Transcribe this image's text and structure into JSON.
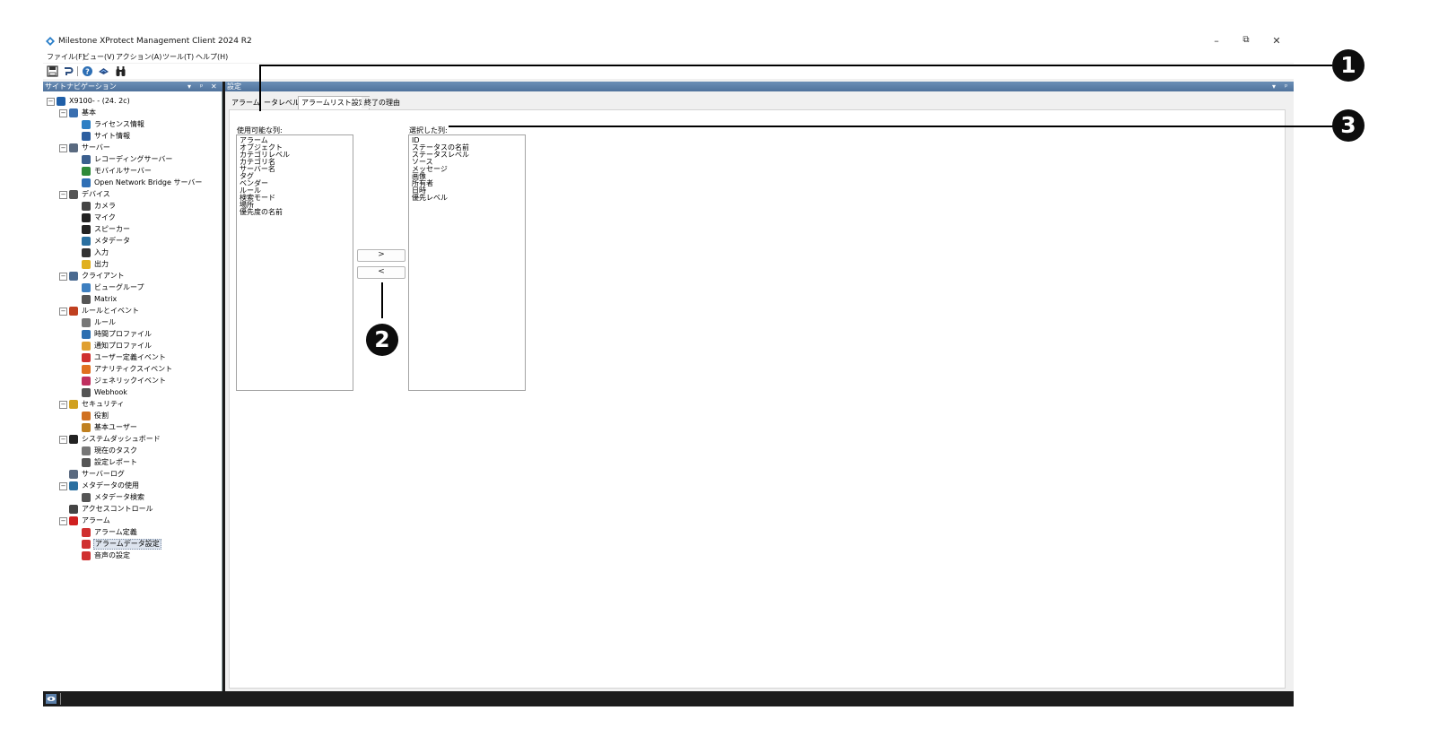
{
  "window": {
    "title": "Milestone XProtect Management Client 2024 R2",
    "minimize_glyph": "–",
    "restore_glyph": "⧉",
    "close_glyph": "✕"
  },
  "menu": [
    "ファイル(F)",
    "ビュー(V)",
    "アクション(A)",
    "ツール(T)",
    "ヘルプ(H)"
  ],
  "toolbar": {
    "icons": [
      "save-icon",
      "undo-icon",
      "help-icon",
      "connect-icon",
      "find-icon"
    ]
  },
  "nav_pane": {
    "title": "サイトナビゲーション",
    "controls": [
      "▾",
      "ᵖ",
      "✕"
    ]
  },
  "tree": [
    {
      "label": "X9100-          - (24. 2c)",
      "level": 0,
      "expander": "⊟",
      "icon": "server-site-icon",
      "color": "#1f5fa8"
    },
    {
      "label": "基本",
      "level": 1,
      "expander": "⊟",
      "icon": "book-icon",
      "color": "#3a6fb0"
    },
    {
      "label": "ライセンス情報",
      "level": 2,
      "icon": "license-icon",
      "color": "#2d7fc4"
    },
    {
      "label": "サイト情報",
      "level": 2,
      "icon": "site-info-icon",
      "color": "#2d5fa0"
    },
    {
      "label": "サーバー",
      "level": 1,
      "expander": "⊟",
      "icon": "server-icon",
      "color": "#5a6a80"
    },
    {
      "label": "レコーディングサーバー",
      "level": 2,
      "icon": "recording-server-icon",
      "color": "#3b5f8e"
    },
    {
      "label": "モバイルサーバー",
      "level": 2,
      "icon": "mobile-server-icon",
      "color": "#2f8a3a"
    },
    {
      "label": "Open Network Bridge サーバー",
      "level": 2,
      "icon": "bridge-icon",
      "color": "#2f6fb5"
    },
    {
      "label": "デバイス",
      "level": 1,
      "expander": "⊟",
      "icon": "devices-icon",
      "color": "#555"
    },
    {
      "label": "カメラ",
      "level": 2,
      "icon": "camera-icon",
      "color": "#444"
    },
    {
      "label": "マイク",
      "level": 2,
      "icon": "microphone-icon",
      "color": "#222"
    },
    {
      "label": "スピーカー",
      "level": 2,
      "icon": "speaker-icon",
      "color": "#222"
    },
    {
      "label": "メタデータ",
      "level": 2,
      "icon": "metadata-icon",
      "color": "#2a6fa0"
    },
    {
      "label": "入力",
      "level": 2,
      "icon": "input-icon",
      "color": "#333"
    },
    {
      "label": "出力",
      "level": 2,
      "icon": "output-icon",
      "color": "#e0b020"
    },
    {
      "label": "クライアント",
      "level": 1,
      "expander": "⊟",
      "icon": "client-icon",
      "color": "#4a6a90"
    },
    {
      "label": "ビューグループ",
      "level": 2,
      "icon": "view-group-icon",
      "color": "#3d7fc0"
    },
    {
      "label": "Matrix",
      "level": 2,
      "icon": "matrix-icon",
      "color": "#555"
    },
    {
      "label": "ルールとイベント",
      "level": 1,
      "expander": "⊟",
      "icon": "rules-events-icon",
      "color": "#c04020"
    },
    {
      "label": "ルール",
      "level": 2,
      "icon": "rule-icon",
      "color": "#777"
    },
    {
      "label": "時間プロファイル",
      "level": 2,
      "icon": "clock-icon",
      "color": "#2d6fb0"
    },
    {
      "label": "通知プロファイル",
      "level": 2,
      "icon": "envelope-icon",
      "color": "#e0a030"
    },
    {
      "label": "ユーザー定義イベント",
      "level": 2,
      "icon": "user-event-icon",
      "color": "#d03030"
    },
    {
      "label": "アナリティクスイベント",
      "level": 2,
      "icon": "analytics-event-icon",
      "color": "#e07020"
    },
    {
      "label": "ジェネリックイベント",
      "level": 2,
      "icon": "generic-event-icon",
      "color": "#c03060"
    },
    {
      "label": "Webhook",
      "level": 2,
      "icon": "webhook-icon",
      "color": "#555"
    },
    {
      "label": "セキュリティ",
      "level": 1,
      "expander": "⊟",
      "icon": "security-icon",
      "color": "#d0a020"
    },
    {
      "label": "役割",
      "level": 2,
      "icon": "role-icon",
      "color": "#d07020"
    },
    {
      "label": "基本ユーザー",
      "level": 2,
      "icon": "basic-user-icon",
      "color": "#c08020"
    },
    {
      "label": "システムダッシュボード",
      "level": 1,
      "expander": "⊟",
      "icon": "dashboard-icon",
      "color": "#222"
    },
    {
      "label": "現在のタスク",
      "level": 2,
      "icon": "task-icon",
      "color": "#777"
    },
    {
      "label": "設定レポート",
      "level": 2,
      "icon": "report-icon",
      "color": "#555"
    },
    {
      "label": "サーバーログ",
      "level": 1,
      "icon": "server-log-icon",
      "color": "#5a6a80"
    },
    {
      "label": "メタデータの使用",
      "level": 1,
      "expander": "⊟",
      "icon": "metadata-use-icon",
      "color": "#2a6fa0"
    },
    {
      "label": "メタデータ検索",
      "level": 2,
      "icon": "metadata-search-icon",
      "color": "#555"
    },
    {
      "label": "アクセスコントロール",
      "level": 1,
      "icon": "access-control-icon",
      "color": "#444"
    },
    {
      "label": "アラーム",
      "level": 1,
      "expander": "⊟",
      "icon": "alarm-icon",
      "color": "#d02020"
    },
    {
      "label": "アラーム定義",
      "level": 2,
      "icon": "alarm-definition-icon",
      "color": "#d03030"
    },
    {
      "label": "アラームデータ設定",
      "level": 2,
      "icon": "alarm-data-icon",
      "color": "#d03030",
      "selected": true
    },
    {
      "label": "音声の設定",
      "level": 2,
      "icon": "sound-settings-icon",
      "color": "#d03030"
    }
  ],
  "settings_pane": {
    "title": "設定",
    "controls": [
      "▾",
      "ᵖ"
    ]
  },
  "tabs": [
    {
      "label": "アラーム",
      "active": false
    },
    {
      "label": "ータレベル",
      "active": false
    },
    {
      "label": "アラームリスト設定",
      "active": true
    },
    {
      "label": "終了の理由",
      "active": false
    }
  ],
  "available_columns": {
    "label": "使用可能な列:",
    "items": [
      "アラーム",
      "オブジェクト",
      "カテゴリレベル",
      "カテゴリ名",
      "サーバー名",
      "タグ",
      "ベンダー",
      "ルール",
      "検索モード",
      "場所",
      "優先度の名前"
    ]
  },
  "selected_columns": {
    "label": "選択した列:",
    "items": [
      "ID",
      "ステータスの名前",
      "ステータスレベル",
      "ソース",
      "メッセージ",
      "画像",
      "所有者",
      "日時",
      "優先レベル"
    ]
  },
  "buttons": {
    "add": ">",
    "remove": "<"
  },
  "callouts": {
    "one": "1",
    "two": "2",
    "three": "3"
  },
  "colors": {
    "pane_header": "#4f729c",
    "callout": "#0d0d0d",
    "selection": "#dde4ee"
  }
}
